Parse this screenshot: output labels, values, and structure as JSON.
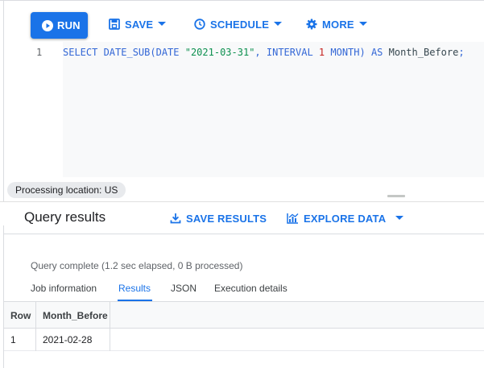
{
  "toolbar": {
    "run_label": "RUN",
    "save_label": "SAVE",
    "schedule_label": "SCHEDULE",
    "more_label": "MORE"
  },
  "editor": {
    "line_number": "1",
    "tokens": {
      "t1": "SELECT DATE_SUB(",
      "t2": "DATE ",
      "t3": "\"2021-03-31\"",
      "t4": ", ",
      "t5": "INTERVAL ",
      "t6": "1",
      "t7": " MONTH) AS ",
      "t8": "Month_Before",
      "t9": ";"
    }
  },
  "processing_location": "Processing location: US",
  "results": {
    "title": "Query results",
    "save_results_label": "SAVE RESULTS",
    "explore_data_label": "EXPLORE DATA",
    "status": "Query complete (1.2 sec elapsed, 0 B processed)"
  },
  "tabs": [
    {
      "label": "Job information",
      "active": false
    },
    {
      "label": "Results",
      "active": true
    },
    {
      "label": "JSON",
      "active": false
    },
    {
      "label": "Execution details",
      "active": false
    }
  ],
  "table": {
    "headers": [
      "Row",
      "Month_Before"
    ],
    "rows": [
      [
        "1",
        "2021-02-28"
      ]
    ]
  },
  "colors": {
    "accent": "#1a73e8",
    "keyword": "#3367d6",
    "string": "#0d904f",
    "number": "#c5221f"
  },
  "icons": {
    "run": "play-circle-icon",
    "save": "save-icon",
    "schedule": "clock-icon",
    "more": "gear-icon",
    "save_results": "download-icon",
    "explore_data": "chart-icon",
    "dropdown": "caret-down-icon"
  }
}
